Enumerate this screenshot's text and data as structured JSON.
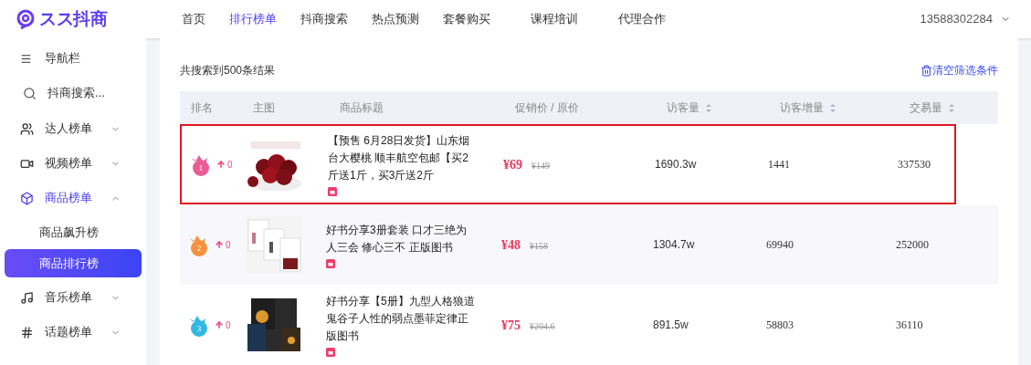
{
  "header": {
    "logo": "スス抖商",
    "nav": [
      {
        "label": "首页",
        "selected": false
      },
      {
        "label": "排行榜单",
        "selected": true
      },
      {
        "label": "抖商搜索",
        "selected": false
      },
      {
        "label": "热点预测",
        "selected": false
      },
      {
        "label": "套餐购买",
        "selected": false
      },
      {
        "label": "课程培训",
        "selected": false
      },
      {
        "label": "代理合作",
        "selected": false
      }
    ],
    "user": "13588302284"
  },
  "sidebar": {
    "items": [
      {
        "kind": "header",
        "label": "导航栏"
      },
      {
        "kind": "search",
        "placeholder": "抖商搜索..."
      },
      {
        "kind": "menu",
        "label": "达人榜单",
        "expanded": false
      },
      {
        "kind": "menu",
        "label": "视频榜单",
        "expanded": false
      },
      {
        "kind": "menu",
        "label": "商品榜单",
        "expanded": true,
        "children": [
          {
            "label": "商品飙升榜",
            "selected": false
          },
          {
            "label": "商品排行榜",
            "selected": true
          }
        ]
      },
      {
        "kind": "menu",
        "label": "音乐榜单",
        "expanded": false
      },
      {
        "kind": "menu",
        "label": "话题榜单",
        "expanded": false
      }
    ]
  },
  "results": {
    "summary": "共搜索到500条结果",
    "clear_filters": "清空筛选条件"
  },
  "table": {
    "columns": [
      {
        "label": "排名",
        "sortable": false
      },
      {
        "label": "主图",
        "sortable": false
      },
      {
        "label": "商品标题",
        "sortable": false
      },
      {
        "label": "促销价 / 原价",
        "sortable": false
      },
      {
        "label": "访客量",
        "sortable": true
      },
      {
        "label": "访客增量",
        "sortable": true
      },
      {
        "label": "交易量",
        "sortable": true
      }
    ],
    "rows": [
      {
        "rank": "1",
        "color": "#ea5c95",
        "change": "0",
        "title": "【预售 6月28日发货】山东烟台大樱桃 顺丰航空包邮【买2斤送1斤，买3斤送2斤",
        "price": "¥69",
        "original_price": "¥149",
        "visitors": "1690.3w",
        "visitor_increase": "1441",
        "transactions": "337530",
        "highlighted": true
      },
      {
        "rank": "2",
        "color": "#f7913d",
        "change": "0",
        "title": "好书分享3册套装 口才三绝为人三会 修心三不 正版图书",
        "price": "¥48",
        "original_price": "¥158",
        "visitors": "1304.7w",
        "visitor_increase": "69940",
        "transactions": "252000",
        "highlighted": false
      },
      {
        "rank": "3",
        "color": "#33b8e0",
        "change": "0",
        "title": "好书分享【5册】九型人格狼道鬼谷子人性的弱点墨菲定律正版图书",
        "price": "¥75",
        "original_price": "¥204.6",
        "visitors": "891.5w",
        "visitor_increase": "58803",
        "transactions": "36110",
        "highlighted": false
      }
    ]
  }
}
